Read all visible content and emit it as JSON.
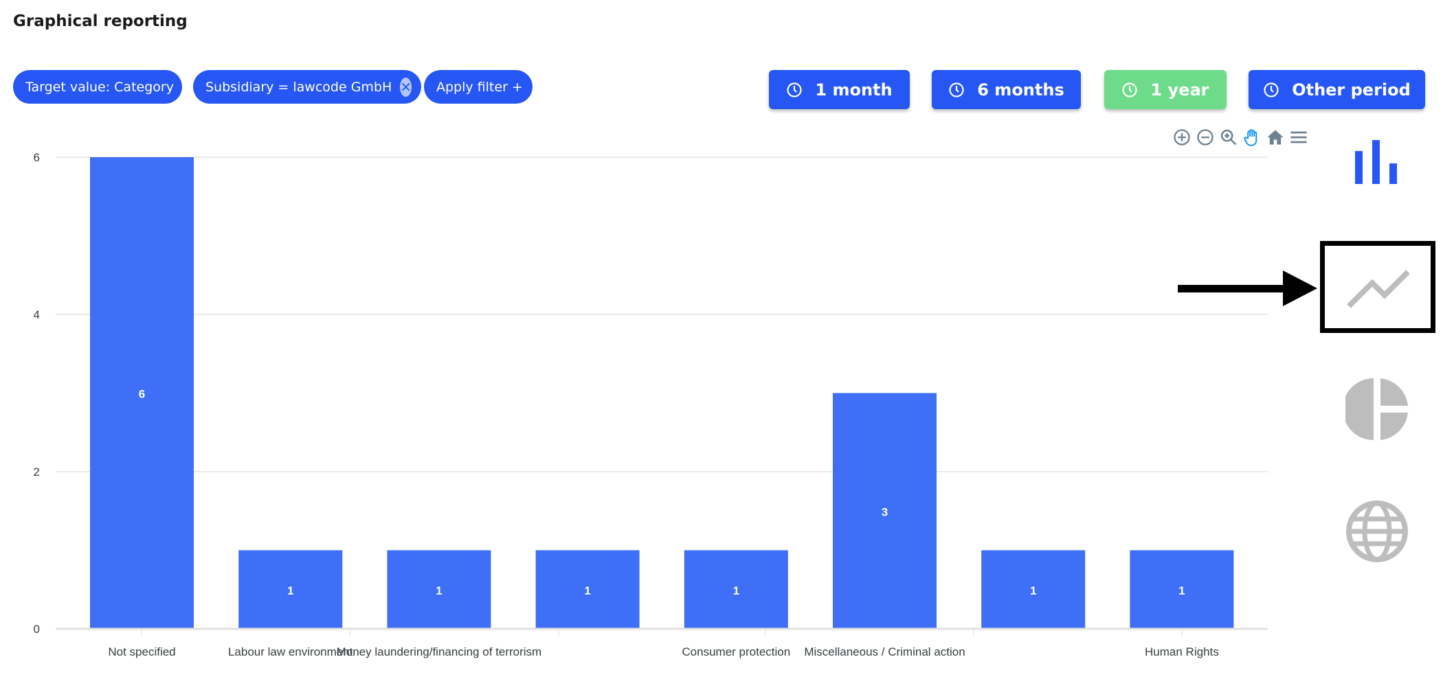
{
  "header": {
    "title": "Graphical reporting"
  },
  "filters": {
    "target": "Target value: Category",
    "subsidiary": "Subsidiary = lawcode GmbH",
    "apply": "Apply filter +",
    "remove_icon": "close-circle-icon"
  },
  "periods": [
    {
      "label": "1 month",
      "active": false
    },
    {
      "label": "6 months",
      "active": false
    },
    {
      "label": "1 year",
      "active": true
    },
    {
      "label": "Other period",
      "active": false
    }
  ],
  "colors": {
    "primary": "#2657f5",
    "active": "#6edb8a",
    "bar": "#3e6ff6",
    "inactive_icon": "#bdbdbd"
  },
  "toolbar": [
    "zoom-in-icon",
    "zoom-out-icon",
    "zoom-select-icon",
    "pan-hand-icon",
    "home-reset-icon",
    "menu-icon"
  ],
  "chart_types": [
    {
      "icon": "bar-chart-icon",
      "selected": true
    },
    {
      "icon": "line-chart-icon",
      "selected": false,
      "highlighted": true
    },
    {
      "icon": "pie-chart-icon",
      "selected": false
    },
    {
      "icon": "globe-map-icon",
      "selected": false
    }
  ],
  "chart_data": {
    "type": "bar",
    "categories": [
      "Not specified",
      "Labour law environment",
      "Money laundering/financing of terrorism",
      "",
      "Consumer protection",
      "Miscellaneous / Criminal action",
      "",
      "Human Rights"
    ],
    "values": [
      6,
      1,
      1,
      1,
      1,
      3,
      1,
      1
    ],
    "data_labels": true,
    "yticks": [
      0,
      2,
      4,
      6
    ],
    "ylim": [
      0,
      6
    ],
    "grid": true
  }
}
